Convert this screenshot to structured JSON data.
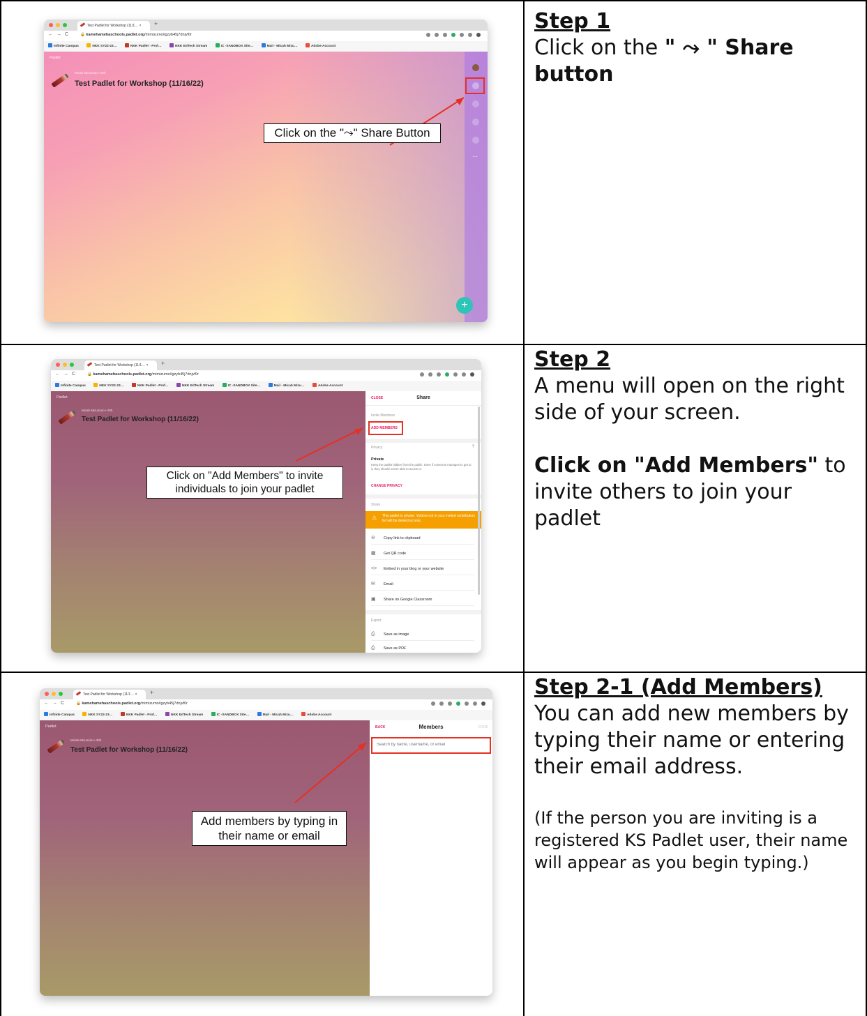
{
  "steps": [
    {
      "title": "Step 1",
      "line1_pre": "Click on the ",
      "line1_bold": "\" ⤳ \" Share",
      "line2_bold": "button"
    },
    {
      "title": "Step 2",
      "text": "A menu will open on the right side of your screen.",
      "cta_bold": "Click on \"Add Members\"",
      "cta_rest": " to invite others to join your padlet"
    },
    {
      "title": "Step 2-1 (Add Members)",
      "text": "You can add new members by typing their name or entering their email address.",
      "note": "(If the person you are inviting is a registered KS Padlet user, their name will appear as you begin typing.)"
    }
  ],
  "browser": {
    "tab_label": "Test Padlet for Workshop (11/1…",
    "tab_close": "×",
    "new_tab": "+",
    "url_host": "kamehamehaschools.padlet.org",
    "url_path": "/mimizumo/igzyb45j7dnjvf0r",
    "bookmarks": [
      "Infinite Campus",
      "NKK SY22-23…",
      "NKK Padlet - Prof…",
      "NKK EdTech Stream",
      "IC -SANDBOX Site…",
      "Mail - Micah Mizu…",
      "Adobe Account"
    ]
  },
  "padlet": {
    "logo": "Padlet",
    "author": "Micah Mizumoto • 20h",
    "title": "Test Padlet for Workshop (11/16/22)"
  },
  "callouts": {
    "step1": "Click on the \"⤳\" Share Button",
    "step2": "Click on \"Add Members\" to invite individuals to join your padlet",
    "step3": "Add members by typing in their name or email"
  },
  "share_panel": {
    "close": "CLOSE",
    "title": "Share",
    "invite_label": "Invite Members",
    "add_members": "ADD MEMBERS",
    "privacy_label": "Privacy",
    "private_title": "Private",
    "private_desc": "Keep the padlet hidden from the public. Even if someone manages to get to it, they should not be able to access it.",
    "change_privacy": "CHANGE PRIVACY",
    "share_label": "Share",
    "warning": "This padlet is private. Visitors not in your invited contributors list will be denied access.",
    "items": [
      "Copy link to clipboard",
      "Get QR code",
      "Embed in your blog or your website",
      "Email",
      "Share on Google Classroom"
    ],
    "export_label": "Export",
    "export_items": [
      "Save as image",
      "Save as PDF"
    ]
  },
  "members_panel": {
    "back": "BACK",
    "title": "Members",
    "done": "DONE",
    "placeholder": "Search by name, username, or email"
  }
}
